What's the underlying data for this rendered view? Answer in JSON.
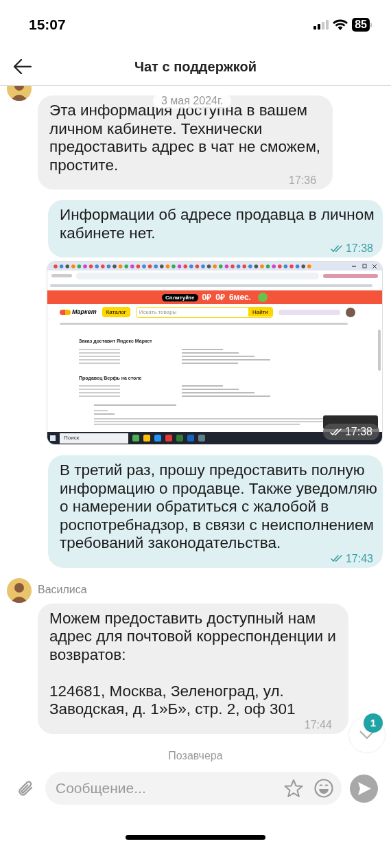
{
  "status_bar": {
    "time": "15:07",
    "battery": "85"
  },
  "header": {
    "title": "Чат с поддержкой"
  },
  "messages": [
    {
      "kind": "incoming",
      "date_overlay": "3 мая 2024г.",
      "text": "Эта информация доступна в вашем\nличном кабинете. Технически\nпредоставить адрес в чат не сможем,\nпростите.",
      "time": "17:36"
    },
    {
      "kind": "outgoing",
      "read": true,
      "text": "Информации об адресе продавца в личном\nкабинете нет.",
      "time": "17:38"
    },
    {
      "kind": "image",
      "read": true,
      "time": "17:38",
      "screenshot": {
        "promo": "Сплитуйте",
        "promo_values": [
          "0₽",
          "0₽",
          "6мес."
        ],
        "logo": "Маркет",
        "catalog": "Каталог",
        "search_placeholder": "Искать товары",
        "search_button": "Найти",
        "section_1": "Заказ доставит Яндекс Маркет",
        "section_2": "Продавец Верфь на столе",
        "taskbar_search": "Поиск"
      }
    },
    {
      "kind": "outgoing",
      "read": true,
      "text": "В третий раз, прошу предоставить полную\nинформацию о продавце. Также уведомляю\nо намерении обратиться с жалобой в\nроспотребнадзор, в связи с неисполнением\nтребований законодательства.",
      "time": "17:43"
    },
    {
      "kind": "sender",
      "name": "Василиса"
    },
    {
      "kind": "incoming",
      "text": "Можем предоставить доступный нам\nадрес для почтовой корреспонденции и\nвозвратов:\n\n124681, Москва, Зеленоград, ул.\nЗаводская, д. 1»Б», стр. 2, оф 301",
      "time": "17:44"
    },
    {
      "kind": "date",
      "label": "Позавчера"
    }
  ],
  "scroll_button": {
    "unread": "1"
  },
  "composer": {
    "placeholder": "Сообщение..."
  }
}
